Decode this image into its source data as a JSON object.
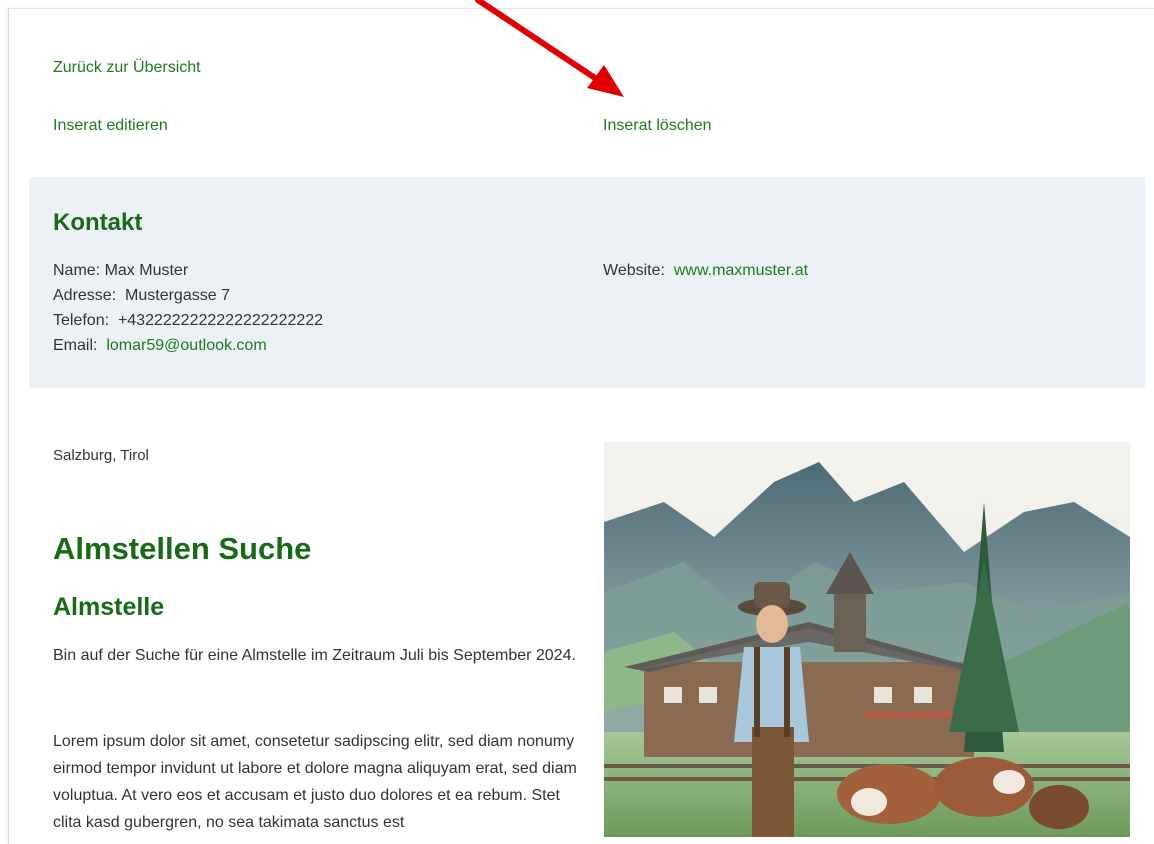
{
  "nav": {
    "back_label": "Zurück zur Übersicht",
    "edit_label": "Inserat editieren",
    "delete_label": "Inserat löschen"
  },
  "contact": {
    "heading": "Kontakt",
    "name_label": "Name:",
    "name_value": "Max Muster",
    "address_label": "Adresse:",
    "address_value": "Mustergasse 7",
    "phone_label": "Telefon:",
    "phone_value": "+4322222222222222222222",
    "email_label": "Email:",
    "email_value": "lomar59@outlook.com",
    "website_label": "Website:",
    "website_value": "www.maxmuster.at"
  },
  "listing": {
    "location": "Salzburg, Tirol",
    "title": "Almstellen Suche",
    "subtitle": "Almstelle",
    "intro": "Bin auf der Suche für eine Almstelle im Zeitraum Juli bis September 2024.",
    "body": "Lorem ipsum dolor sit amet, consetetur sadipscing elitr, sed diam nonumy eirmod tempor invidunt ut labore et dolore magna aliquyam erat, sed diam voluptua. At vero eos et accusam et justo duo dolores et ea rebum. Stet clita kasd gubergren, no sea takimata sanctus est"
  },
  "colors": {
    "link_green": "#1f7a1f",
    "heading_green": "#176b17",
    "contact_bg": "#ecf1f5",
    "annotation_arrow": "#e00000"
  }
}
